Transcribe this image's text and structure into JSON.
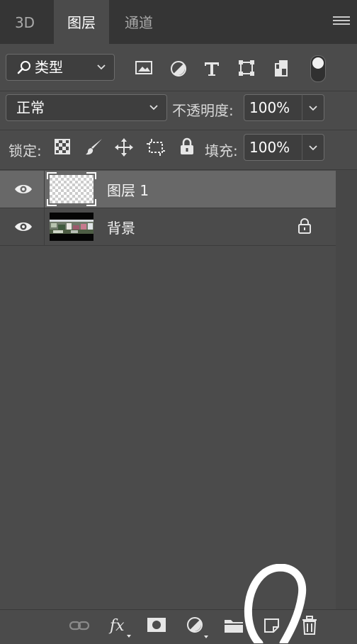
{
  "tabs": [
    {
      "label": "3D",
      "active": false
    },
    {
      "label": "图层",
      "active": true
    },
    {
      "label": "通道",
      "active": false
    }
  ],
  "filter": {
    "kind_label": "类型",
    "icons": [
      "image-filter-icon",
      "adjustment-filter-icon",
      "type-filter-icon",
      "shape-filter-icon",
      "smart-object-filter-icon",
      "filter-toggle-switch"
    ]
  },
  "blend": {
    "mode": "正常",
    "opacity_label": "不透明度:",
    "opacity_value": "100%"
  },
  "lock": {
    "label": "锁定:",
    "icons": [
      "lock-transparent-icon",
      "lock-image-icon",
      "lock-position-icon",
      "lock-artboard-icon",
      "lock-all-icon"
    ],
    "fill_label": "填充:",
    "fill_value": "100%"
  },
  "layers": [
    {
      "name": "图层 1",
      "visible": true,
      "selected": true,
      "locked": false,
      "thumb": "transparent"
    },
    {
      "name": "背景",
      "visible": true,
      "selected": false,
      "locked": true,
      "thumb": "photo"
    }
  ],
  "bottom_icons": [
    "link-layers-icon",
    "fx-icon",
    "add-mask-icon",
    "new-adjustment-icon",
    "new-group-icon",
    "new-layer-icon",
    "delete-layer-icon"
  ],
  "colors": {
    "panel_bg": "#4b4b4b",
    "tabbar_bg": "#353535",
    "selected_row": "#686868",
    "field_bg": "#3e3e3e"
  }
}
